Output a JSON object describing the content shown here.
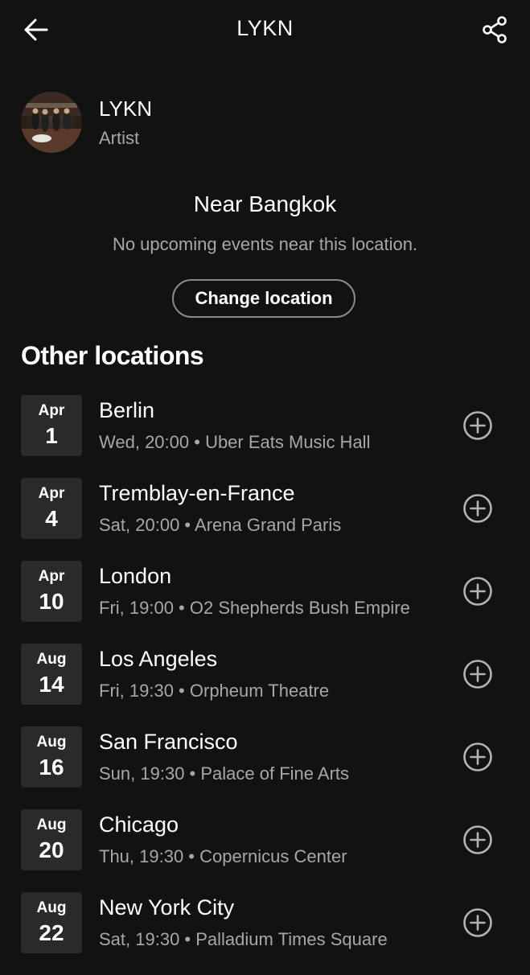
{
  "header": {
    "title": "LYKN",
    "back_icon": "arrow-left-icon",
    "share_icon": "share-icon"
  },
  "artist": {
    "name": "LYKN",
    "type": "Artist"
  },
  "near": {
    "title": "Near Bangkok",
    "message": "No upcoming events near this location.",
    "button_label": "Change location"
  },
  "other": {
    "title": "Other locations",
    "events": [
      {
        "month": "Apr",
        "day": "1",
        "city": "Berlin",
        "when": "Wed, 20:00",
        "venue": "Uber Eats Music Hall"
      },
      {
        "month": "Apr",
        "day": "4",
        "city": "Tremblay-en-France",
        "when": "Sat, 20:00",
        "venue": "Arena Grand Paris"
      },
      {
        "month": "Apr",
        "day": "10",
        "city": "London",
        "when": "Fri, 19:00",
        "venue": "O2 Shepherds Bush Empire"
      },
      {
        "month": "Aug",
        "day": "14",
        "city": "Los Angeles",
        "when": "Fri, 19:30",
        "venue": "Orpheum Theatre"
      },
      {
        "month": "Aug",
        "day": "16",
        "city": "San Francisco",
        "when": "Sun, 19:30",
        "venue": "Palace of Fine Arts"
      },
      {
        "month": "Aug",
        "day": "20",
        "city": "Chicago",
        "when": "Thu, 19:30",
        "venue": "Copernicus Center"
      },
      {
        "month": "Aug",
        "day": "22",
        "city": "New York City",
        "when": "Sat, 19:30",
        "venue": "Palladium Times Square"
      }
    ]
  },
  "colors": {
    "background": "#121212",
    "secondary_text": "#a7a7a7",
    "date_box": "#2a2a2a"
  }
}
